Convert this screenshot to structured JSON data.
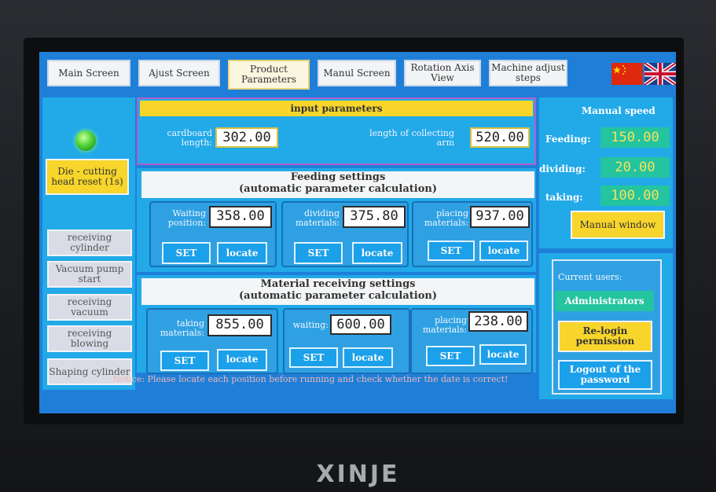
{
  "nav": {
    "tabs": [
      {
        "label": "Main Screen"
      },
      {
        "label": "Ajust Screen"
      },
      {
        "label": "Product Parameters"
      },
      {
        "label": "Manul Screen"
      },
      {
        "label": "Rotation Axis View"
      },
      {
        "label": "Machine adjust steps"
      }
    ],
    "active_index": 2
  },
  "sidebar": {
    "reset_label": "Die - cutting head reset (1s)",
    "buttons": [
      {
        "label": "receiving cylinder"
      },
      {
        "label": "Vacuum pump start"
      },
      {
        "label": "receiving vacuum"
      },
      {
        "label": "receiving blowing"
      },
      {
        "label": "Shaping cylinder"
      }
    ]
  },
  "input_params": {
    "title": "input parameters",
    "cardboard_label": "cardboard length:",
    "cardboard_value": "302.00",
    "collect_label": "length of collecting arm",
    "collect_value": "520.00"
  },
  "feeding": {
    "title": "Feeding settings",
    "subtitle": "(automatic parameter calculation)",
    "groups": [
      {
        "label": "Waiting position:",
        "value": "358.00",
        "set": "SET",
        "locate": "locate"
      },
      {
        "label": "dividing materials:",
        "value": "375.80",
        "set": "SET",
        "locate": "locate"
      },
      {
        "label": "placing materials:",
        "value": "937.00",
        "set": "SET",
        "locate": "locate"
      }
    ]
  },
  "receiving": {
    "title": "Material receiving settings",
    "subtitle": "(automatic parameter calculation)",
    "groups": [
      {
        "label": "taking materials:",
        "value": "855.00",
        "set": "SET",
        "locate": "locate"
      },
      {
        "label": "waiting:",
        "value": "600.00",
        "set": "SET",
        "locate": "locate"
      },
      {
        "label": "placing materials:",
        "value": "238.00",
        "set": "SET",
        "locate": "locate"
      }
    ]
  },
  "notice": "Notice: Please locate each position before running and check whether the date is correct!",
  "manual_speed": {
    "title": "Manual speed",
    "rows": [
      {
        "label": "Feeding:",
        "value": "150.00"
      },
      {
        "label": "dividing:",
        "value": "20.00"
      },
      {
        "label": "taking:",
        "value": "100.00"
      }
    ],
    "window_label": "Manual window"
  },
  "users": {
    "current_label": "Current users:",
    "current_user": "Administrators",
    "relogin_label": "Re-login permission",
    "logout_label": "Logout of the password"
  },
  "brand": "XINJE",
  "colors": {
    "accent_yellow": "#f7d52b",
    "panel_blue": "#22a9e8",
    "speed_teal": "#24c49f"
  }
}
